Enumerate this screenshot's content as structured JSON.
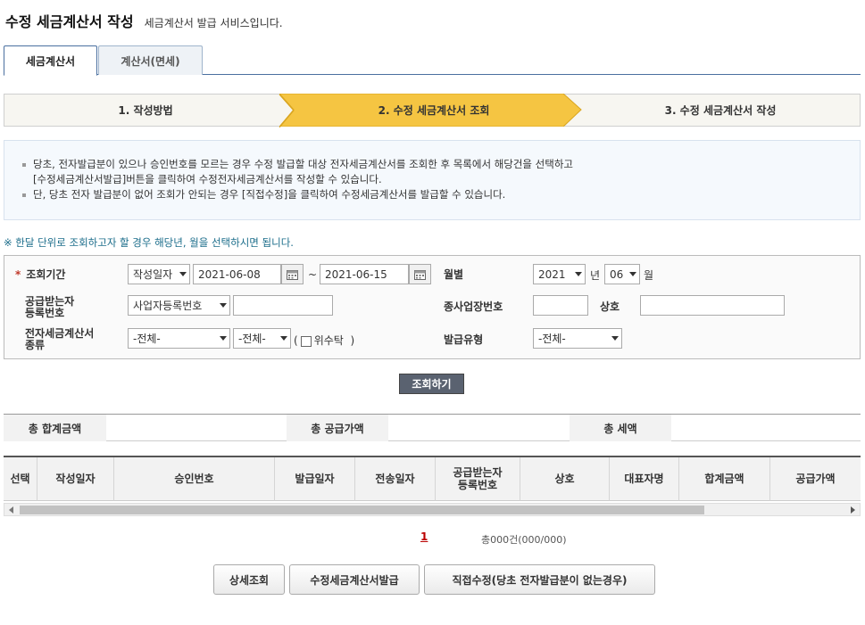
{
  "header": {
    "title": "수정 세금계산서 작성",
    "subtitle": "세금계산서 발급 서비스입니다."
  },
  "tabs": [
    {
      "label": "세금계산서",
      "active": true
    },
    {
      "label": "계산서(면세)",
      "active": false
    }
  ],
  "steps": [
    {
      "label": "1. 작성방법"
    },
    {
      "label": "2. 수정 세금계산서 조회",
      "active": true
    },
    {
      "label": "3. 수정 세금계산서 작성"
    }
  ],
  "info": {
    "line1": "당초, 전자발급분이 있으나 승인번호를 모르는 경우 수정 발급할 대상 전자세금계산서를 조회한 후 목록에서 해당건을 선택하고",
    "line2": "[수정세금계산서발급]버튼을 클릭하여 수정전자세금계산서를 작성할 수 있습니다.",
    "line3": "단, 당초 전자 발급분이 없어 조회가 안되는 경우 [직접수정]을 클릭하여 수정세금계산서를 발급할 수 있습니다."
  },
  "notice": "※ 한달 단위로 조회하고자 할 경우 해당년, 월을 선택하시면 됩니다.",
  "search": {
    "period_label": "조회기간",
    "period_type": "작성일자",
    "date_from": "2021-06-08",
    "tilde": "~",
    "date_to": "2021-06-15",
    "monthly_label": "월별",
    "year": "2021",
    "year_unit": "년",
    "month": "06",
    "month_unit": "월",
    "recipient_label_1": "공급받는자",
    "recipient_label_2": "등록번호",
    "recipient_type": "사업자등록번호",
    "recipient_value": "",
    "branch_label": "종사업장번호",
    "branch_value": "",
    "company_label": "상호",
    "company_value": "",
    "kind_label_1": "전자세금계산서",
    "kind_label_2": "종류",
    "kind_1": "-전체-",
    "kind_2": "-전체-",
    "paren_open": "(",
    "consign_label": "위수탁",
    "paren_close": ")",
    "issue_type_label": "발급유형",
    "issue_type": "-전체-",
    "search_button": "조회하기"
  },
  "summary": {
    "total_label": "총 합계금액",
    "supply_label": "총 공급가액",
    "tax_label": "총 세액"
  },
  "grid": {
    "columns": [
      "선택",
      "작성일자",
      "승인번호",
      "발급일자",
      "전송일자",
      "공급받는자",
      "등록번호",
      "상호",
      "대표자명",
      "합계금액",
      "공급가액"
    ]
  },
  "pager": {
    "page": "1",
    "total": "총000건(000/000)"
  },
  "buttons": {
    "detail": "상세조회",
    "issue": "수정세금계산서발급",
    "direct": "직접수정(당초 전자발급분이 없는경우)"
  }
}
